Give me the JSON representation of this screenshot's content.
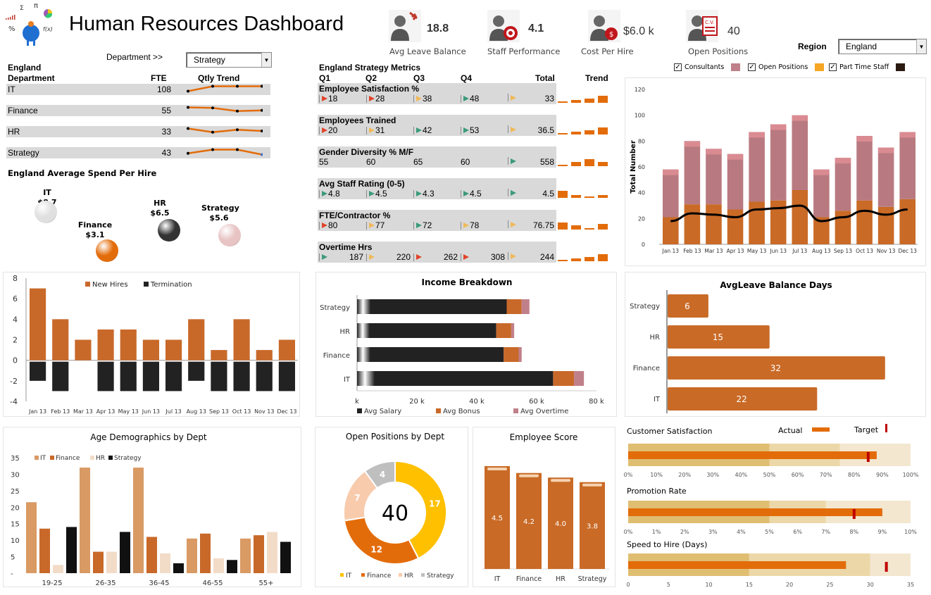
{
  "header": {
    "title": "Human Resources Dashboard",
    "logo": "math-mascot-logo"
  },
  "department_selector": {
    "label": "Department >>",
    "value": "Strategy"
  },
  "region_selector": {
    "label": "Region",
    "value": "England"
  },
  "kpis": [
    {
      "icon": "person-plane-icon",
      "value": "18.8",
      "label": "Avg Leave Balance"
    },
    {
      "icon": "person-target-icon",
      "value": "4.1",
      "label": "Staff Performance"
    },
    {
      "icon": "person-dollar-icon",
      "value": "$6.0 k",
      "label": "Cost Per Hire"
    },
    {
      "icon": "person-cv-icon",
      "value": "40",
      "label": "Open Positions"
    }
  ],
  "dept_table": {
    "region": "England",
    "col_dept": "Department",
    "col_fte": "FTE",
    "col_trend": "Qtly Trend",
    "rows": [
      {
        "name": "IT",
        "fte": "108",
        "trend": [
          1,
          3,
          3,
          3
        ]
      },
      {
        "name": "Finance",
        "fte": "55",
        "trend": [
          3,
          2.8,
          1.5,
          1.8
        ]
      },
      {
        "name": "HR",
        "fte": "33",
        "trend": [
          3,
          1.5,
          2.5,
          2
        ]
      },
      {
        "name": "Strategy",
        "fte": "43",
        "trend": [
          1.5,
          3,
          3,
          1
        ]
      }
    ]
  },
  "spend_per_hire": {
    "title": "England Average Spend Per Hire",
    "items": [
      {
        "name": "IT",
        "value": "$8.7",
        "color": "#e0e0e0"
      },
      {
        "name": "Finance",
        "value": "$3.1",
        "color": "#e36c0a"
      },
      {
        "name": "HR",
        "value": "$6.5",
        "color": "#333333"
      },
      {
        "name": "Strategy",
        "value": "$5.6",
        "color": "#e8c4c4"
      }
    ]
  },
  "metrics": {
    "title": "England Strategy Metrics",
    "cols": [
      "Q1",
      "Q2",
      "Q3",
      "Q4",
      "Total",
      "Trend"
    ],
    "rows": [
      {
        "name": "Employee Satisfaction %",
        "q": [
          "18",
          "28",
          "38",
          "48"
        ],
        "flags": [
          "red",
          "red",
          "amber",
          "green"
        ],
        "total_flag": "amber",
        "total": "33",
        "trend": [
          1,
          2,
          3,
          5
        ]
      },
      {
        "name": "Employees Trained",
        "q": [
          "20",
          "31",
          "42",
          "53"
        ],
        "flags": [
          "red",
          "amber",
          "green",
          "green"
        ],
        "total_flag": "amber",
        "total": "36.5",
        "trend": [
          1,
          2,
          3,
          5
        ]
      },
      {
        "name": "Gender Diversity % M/F",
        "q": [
          "55",
          "60",
          "65",
          "60"
        ],
        "flags": [
          null,
          null,
          null,
          null
        ],
        "total_flag": "green",
        "total": "558",
        "trend": [
          1,
          3,
          5,
          3
        ]
      },
      {
        "name": "Avg Staff Rating (0-5)",
        "q": [
          "4.8",
          "4.5",
          "4.3",
          "4.5"
        ],
        "flags": [
          "green",
          "green",
          "green",
          "green"
        ],
        "total_flag": "green",
        "total": "4.5",
        "trend": [
          5,
          2,
          1,
          2
        ]
      },
      {
        "name": "FTE/Contractor %",
        "q": [
          "80",
          "77",
          "72",
          "78"
        ],
        "flags": [
          "red",
          "amber",
          "green",
          "amber"
        ],
        "total_flag": "amber",
        "total": "76.75",
        "trend": [
          5,
          3,
          1,
          4
        ]
      },
      {
        "name": "Overtime Hrs",
        "q": [
          "187",
          "220",
          "262",
          "308"
        ],
        "flags": [
          "green",
          "amber",
          "red",
          "red"
        ],
        "total_flag": "amber",
        "total": "244",
        "trend": [
          1,
          2,
          3,
          5
        ]
      }
    ]
  },
  "staff_chart": {
    "legend": [
      {
        "label": "Consultants",
        "checked": true,
        "color": "#c0808a"
      },
      {
        "label": "Open Positions",
        "checked": true,
        "color": "#f5a623"
      },
      {
        "label": "Part Time Staff",
        "checked": true,
        "color": "#2a1a10"
      }
    ]
  },
  "chart_data": [
    {
      "id": "staff_totals",
      "type": "bar",
      "ylabel": "Total Number",
      "ylim": [
        0,
        120
      ],
      "yticks": [
        0,
        20,
        40,
        60,
        80,
        100,
        120
      ],
      "categories": [
        "Jan 13",
        "Feb 13",
        "Mar 13",
        "Apr 13",
        "May 13",
        "Jun 13",
        "Jul 13",
        "Aug 13",
        "Sep 13",
        "Oct 13",
        "Nov 13",
        "Dec 13"
      ],
      "series": [
        {
          "name": "Open Positions",
          "values": [
            21,
            31,
            31,
            27,
            33,
            34,
            42,
            21,
            26,
            34,
            29,
            35
          ]
        },
        {
          "name": "Consultants",
          "values": [
            37,
            49,
            43,
            43,
            54,
            59,
            58,
            37,
            41,
            50,
            46,
            52
          ]
        },
        {
          "name": "Part Time Staff",
          "type": "line",
          "values": [
            18,
            24,
            23,
            21,
            27,
            28,
            30,
            18,
            21,
            26,
            23,
            27
          ]
        }
      ]
    },
    {
      "id": "hires_terms",
      "type": "bar",
      "ylim": [
        -4,
        8
      ],
      "yticks": [
        -4,
        -2,
        0,
        2,
        4,
        6,
        8
      ],
      "categories": [
        "Jan 13",
        "Feb 13",
        "Mar 13",
        "Apr 13",
        "May 13",
        "Jun 13",
        "Jul 13",
        "Aug 13",
        "Sep 13",
        "Oct 13",
        "Nov 13",
        "Dec 13"
      ],
      "series": [
        {
          "name": "New Hires",
          "color": "#c8692a",
          "values": [
            7,
            4,
            2,
            3,
            3,
            2,
            2,
            4,
            1,
            4,
            1,
            2
          ]
        },
        {
          "name": "Termination",
          "color": "#222222",
          "values": [
            -2,
            -3,
            0,
            -3,
            -3,
            -3,
            -3,
            -2,
            -3,
            -3,
            -3,
            -3
          ]
        }
      ]
    },
    {
      "id": "income",
      "type": "bar",
      "title": "Income Breakdown",
      "orientation": "horizontal",
      "xlim": [
        0,
        80
      ],
      "xticks": [
        "k",
        "20 k",
        "40 k",
        "60 k",
        "80 k"
      ],
      "categories": [
        "Strategy",
        "HR",
        "Finance",
        "IT"
      ],
      "series": [
        {
          "name": "Avg Salary",
          "color": "#222222",
          "values": [
            50,
            46.5,
            49,
            65.5
          ]
        },
        {
          "name": "Avg Bonus",
          "color": "#c8692a",
          "values": [
            5,
            5,
            5,
            7
          ]
        },
        {
          "name": "Avg Overtime",
          "color": "#c0808a",
          "values": [
            2.6,
            1,
            1,
            3.3
          ]
        }
      ]
    },
    {
      "id": "leave",
      "type": "bar",
      "title": "AvgLeave Balance Days",
      "orientation": "horizontal",
      "xlim": [
        0,
        36
      ],
      "categories": [
        "Strategy",
        "HR",
        "Finance",
        "IT"
      ],
      "values": [
        6,
        15,
        32,
        22
      ]
    },
    {
      "id": "age",
      "type": "bar",
      "title": "Age Demographics by Dept",
      "ylim": [
        0,
        35
      ],
      "yticks": [
        "-",
        "5",
        "10",
        "15",
        "20",
        "25",
        "30",
        "35"
      ],
      "categories": [
        "19-25",
        "26-35",
        "36-45",
        "46-55",
        "55+"
      ],
      "series": [
        {
          "name": "IT",
          "color": "#d99a64",
          "values": [
            21.5,
            32,
            32,
            10.5,
            10.5
          ]
        },
        {
          "name": "Finance",
          "color": "#c8692a",
          "values": [
            13.5,
            6.5,
            11,
            12,
            11.5
          ]
        },
        {
          "name": "HR",
          "color": "#f2dcc8",
          "values": [
            2.5,
            6.5,
            6,
            4.5,
            12.5
          ]
        },
        {
          "name": "Strategy",
          "color": "#111111",
          "values": [
            14,
            12.5,
            3,
            4,
            9.5
          ]
        }
      ]
    },
    {
      "id": "open_positions",
      "type": "pie",
      "title": "Open Positions by Dept",
      "center_label": "40",
      "categories": [
        "IT",
        "Finance",
        "HR",
        "Strategy"
      ],
      "values": [
        17,
        12,
        7,
        4
      ],
      "colors": [
        "#ffc000",
        "#e36c0a",
        "#f8cbad",
        "#bfbfbf"
      ]
    },
    {
      "id": "employee_score",
      "type": "bar",
      "title": "Employee Score",
      "ylim": [
        0,
        5
      ],
      "categories": [
        "IT",
        "Finance",
        "HR",
        "Strategy"
      ],
      "values": [
        4.5,
        4.2,
        4.0,
        3.8
      ],
      "labels": [
        "4.5",
        "4.2",
        "4.0",
        "3.8"
      ]
    },
    {
      "id": "bullets",
      "type": "bullet",
      "legend": {
        "actual": "Actual",
        "target": "Target"
      },
      "items": [
        {
          "title": "Customer Satisfaction",
          "ranges": [
            50,
            75,
            100
          ],
          "actual": 88,
          "target": 85,
          "max": 100,
          "ticks": [
            "0%",
            "10%",
            "20%",
            "30%",
            "40%",
            "50%",
            "60%",
            "70%",
            "80%",
            "90%",
            "100%"
          ]
        },
        {
          "title": "Promotion Rate",
          "ranges": [
            5,
            7,
            10
          ],
          "actual": 9,
          "target": 8,
          "max": 10,
          "ticks": [
            "0%",
            "1%",
            "2%",
            "3%",
            "4%",
            "5%",
            "6%",
            "7%",
            "8%",
            "9%",
            "10%"
          ]
        },
        {
          "title": "Speed to Hire (Days)",
          "ranges": [
            15,
            30,
            35
          ],
          "actual": 27,
          "target": 32,
          "max": 35,
          "ticks": [
            "0",
            "5",
            "10",
            "15",
            "20",
            "25",
            "30",
            "35"
          ]
        }
      ]
    }
  ]
}
